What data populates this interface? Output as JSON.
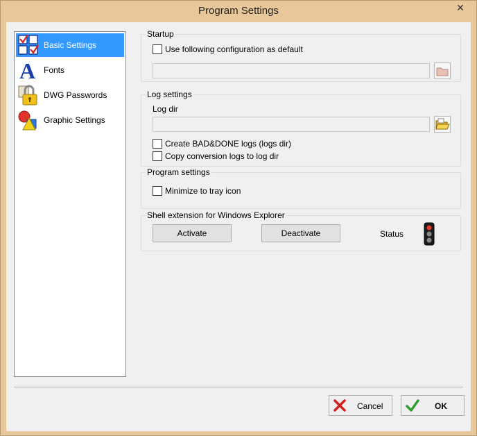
{
  "window": {
    "title": "Program Settings",
    "close_glyph": "✕"
  },
  "nav": {
    "items": [
      {
        "label": "Basic Settings",
        "icon": "checklist-icon",
        "selected": true
      },
      {
        "label": "Fonts",
        "icon": "font-a-icon",
        "selected": false
      },
      {
        "label": "DWG Passwords",
        "icon": "padlock-icon",
        "selected": false
      },
      {
        "label": "Graphic Settings",
        "icon": "shapes-icon",
        "selected": false
      }
    ]
  },
  "startup": {
    "title": "Startup",
    "use_default_label": "Use following configuration as default",
    "use_default_checked": false,
    "config_path": ""
  },
  "log_settings": {
    "title": "Log settings",
    "log_dir_label": "Log dir",
    "log_dir_value": "",
    "bad_done_label": "Create BAD&DONE logs (logs dir)",
    "bad_done_checked": false,
    "copy_logs_label": "Copy conversion logs to log dir",
    "copy_logs_checked": false
  },
  "program_settings": {
    "title": "Program settings",
    "minimize_label": "Minimize to tray icon",
    "minimize_checked": false
  },
  "shell": {
    "title": "Shell extension for Windows Explorer",
    "activate_label": "Activate",
    "deactivate_label": "Deactivate",
    "status_label": "Status",
    "status_icon": "traffic-light-icon"
  },
  "footer": {
    "cancel_label": "Cancel",
    "ok_label": "OK"
  },
  "colors": {
    "selection": "#3399ff",
    "frame": "#e8c79a",
    "ok_check": "#2e9e2e",
    "cancel_x": "#d22020"
  }
}
